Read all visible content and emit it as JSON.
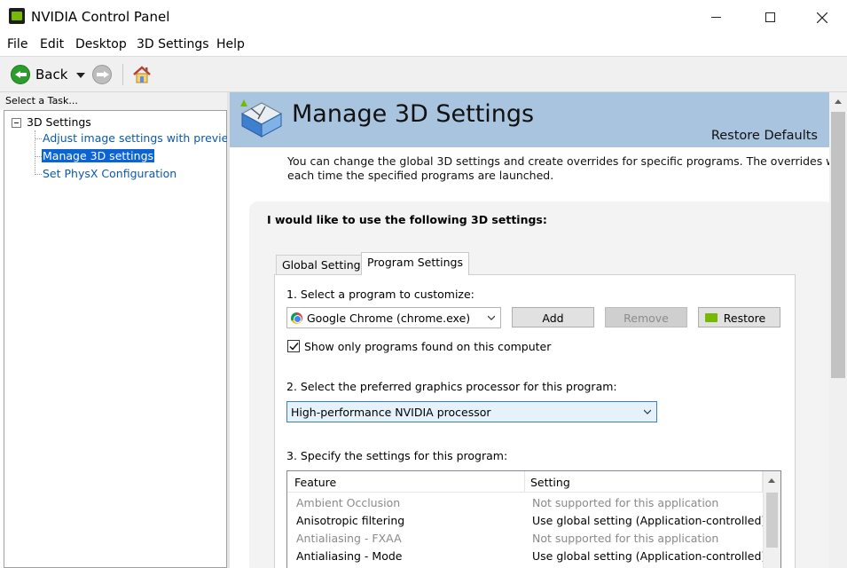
{
  "window": {
    "title": "NVIDIA Control Panel"
  },
  "menu": [
    "File",
    "Edit",
    "Desktop",
    "3D Settings",
    "Help"
  ],
  "toolbar": {
    "back_label": "Back"
  },
  "task_pane": {
    "header": "Select a Task...",
    "root": "3D Settings",
    "items": [
      "Adjust image settings with preview",
      "Manage 3D settings",
      "Set PhysX Configuration"
    ],
    "selected_index": 1
  },
  "page": {
    "title": "Manage 3D Settings",
    "restore_defaults": "Restore Defaults",
    "description_line1": "You can change the global 3D settings and create overrides for specific programs. The overrides will be",
    "description_line2": "each time the specified programs are launched.",
    "panel_heading": "I would like to use the following 3D settings:",
    "tabs": [
      "Global Settings",
      "Program Settings"
    ],
    "active_tab": "Program Settings",
    "step1_label": "1. Select a program to customize:",
    "program_selected": "Google Chrome (chrome.exe)",
    "buttons": {
      "add": "Add",
      "remove": "Remove",
      "restore": "Restore"
    },
    "show_only_label": "Show only programs found on this computer",
    "show_only_checked": true,
    "step2_label": "2. Select the preferred graphics processor for this program:",
    "gpu_selected": "High-performance NVIDIA processor",
    "step3_label": "3. Specify the settings for this program:",
    "table": {
      "columns": [
        "Feature",
        "Setting"
      ],
      "rows": [
        {
          "feature": "Ambient Occlusion",
          "setting": "Not supported for this application",
          "muted": true
        },
        {
          "feature": "Anisotropic filtering",
          "setting": "Use global setting (Application-controlled)",
          "muted": false
        },
        {
          "feature": "Antialiasing - FXAA",
          "setting": "Not supported for this application",
          "muted": true
        },
        {
          "feature": "Antialiasing - Mode",
          "setting": "Use global setting (Application-controlled)",
          "muted": false
        }
      ]
    }
  },
  "colors": {
    "banner": "#a8c4df",
    "link": "#0a58b3",
    "selection": "#0a64d6",
    "nvidia_green": "#76b900"
  }
}
